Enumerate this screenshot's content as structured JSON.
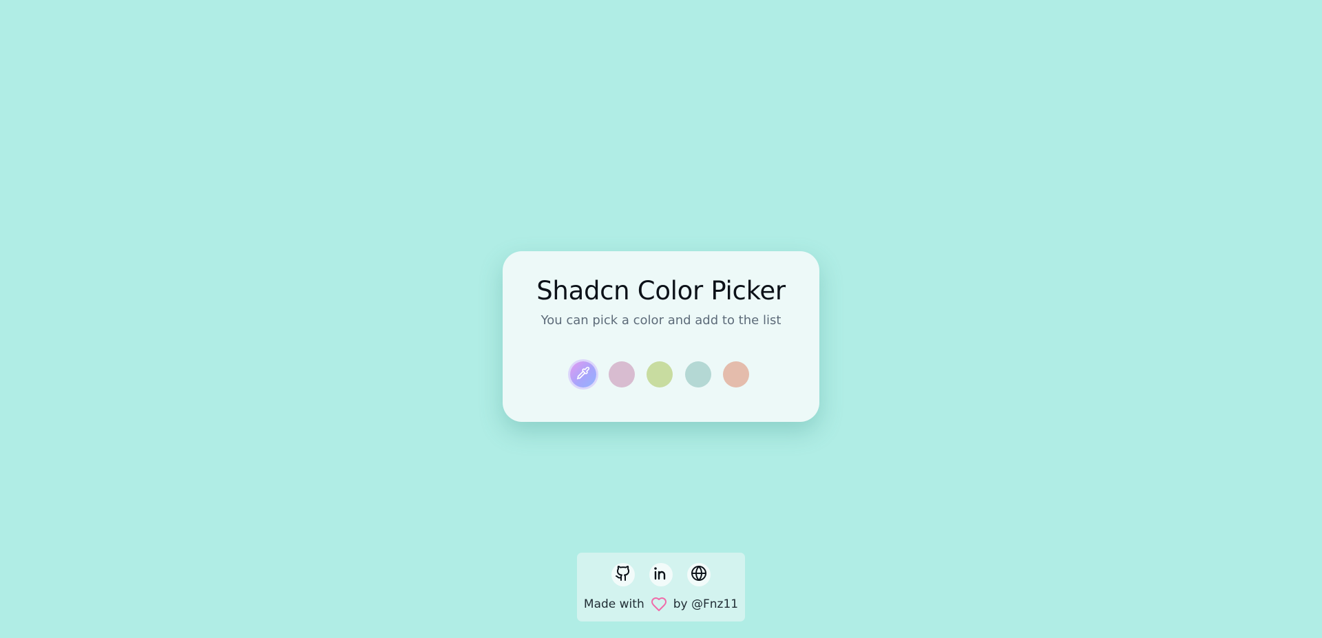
{
  "card": {
    "title": "Shadcn Color Picker",
    "subtitle": "You can pick a color and add to the list"
  },
  "swatches": [
    {
      "kind": "eyedropper-picker",
      "icon": "eyedropper-icon",
      "color": "#b4a0f8"
    },
    {
      "kind": "color",
      "color": "#d8bcd0"
    },
    {
      "kind": "color",
      "color": "#c8dca0"
    },
    {
      "kind": "color",
      "color": "#b4d8d4"
    },
    {
      "kind": "color",
      "color": "#e4bcac"
    }
  ],
  "footer": {
    "links": [
      {
        "icon": "github-icon"
      },
      {
        "icon": "linkedin-icon"
      },
      {
        "icon": "globe-icon"
      }
    ],
    "made_with": "Made with",
    "heart_icon": "heart-icon",
    "heart_color": "#f06aa8",
    "by": "by @Fnz11"
  },
  "colors": {
    "background": "#b0ede5",
    "card": "#edf9f8",
    "footer": "#d3f3ef"
  }
}
